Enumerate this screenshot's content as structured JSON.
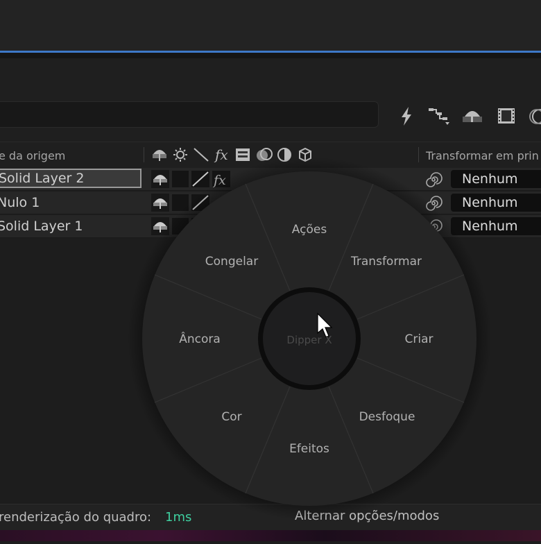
{
  "header": {
    "column_source_name": "e da origem",
    "column_parent": "Transformar em prin"
  },
  "toolbar_icons": [
    "lightning-icon",
    "flowchart-icon",
    "shy-layer-icon",
    "film-icon",
    "motion-blur-icon"
  ],
  "layers": [
    {
      "name": "Solid Layer 2",
      "parent": "Nenhum",
      "selected": true
    },
    {
      "name": "Nulo 1",
      "parent": "Nenhum",
      "selected": false
    },
    {
      "name": "Solid Layer 1",
      "parent": "Nenhum",
      "selected": false
    }
  ],
  "pie_menu": {
    "center": "Dipper X",
    "items": {
      "top": "Ações",
      "top_right": "Transformar",
      "right": "Criar",
      "bottom_right": "Desfoque",
      "bottom": "Efeitos",
      "bottom_left": "Cor",
      "left": "Âncora",
      "top_left": "Congelar"
    }
  },
  "status_bar": {
    "render_label": "renderização do quadro:",
    "render_value": "1ms",
    "toggle_label": "Alternar opções/modos"
  },
  "colors": {
    "accent_blue": "#3d78c8",
    "render_value": "#3fd0a0"
  }
}
